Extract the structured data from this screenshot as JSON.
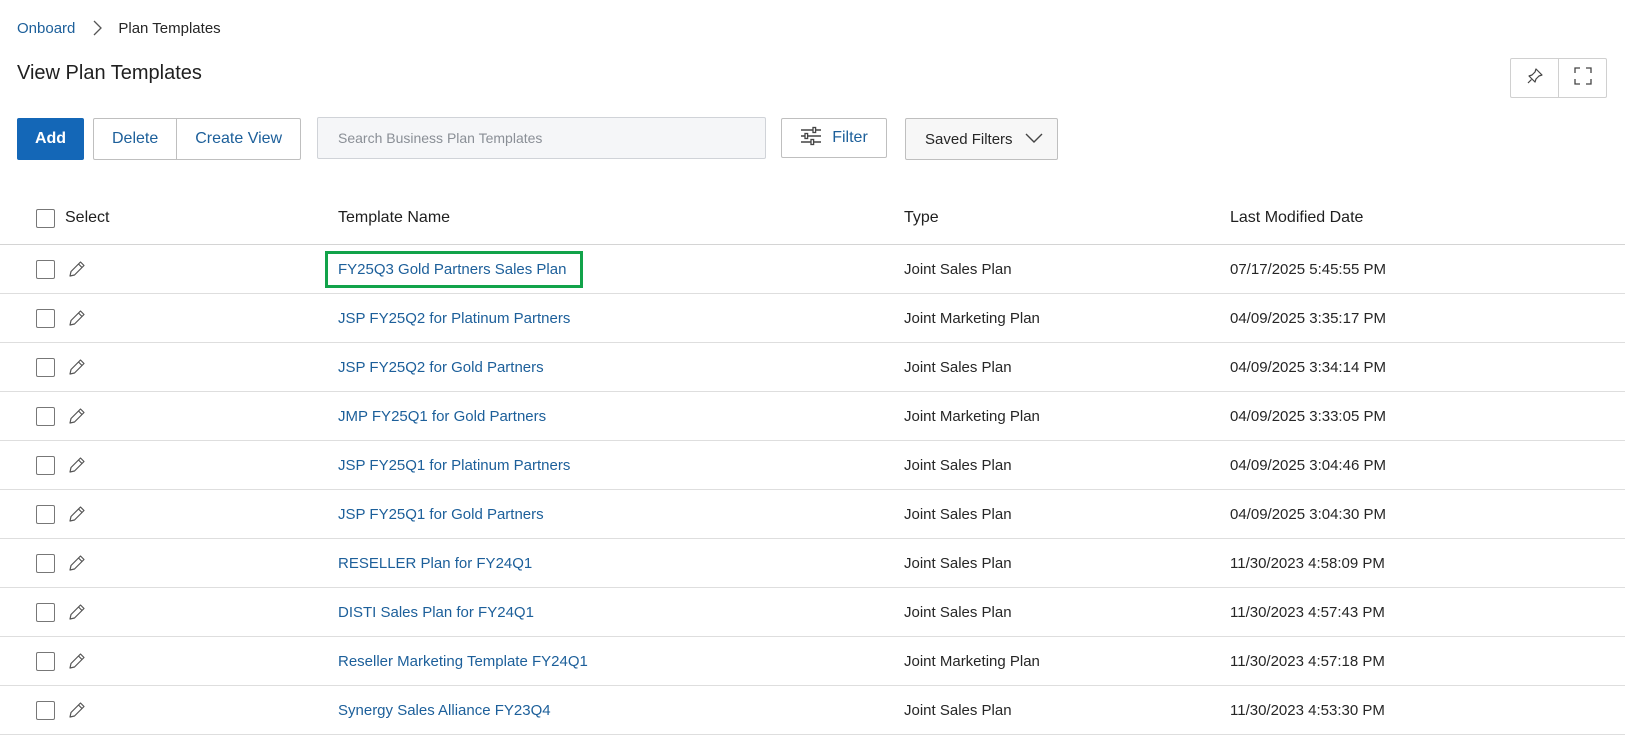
{
  "breadcrumb": {
    "parent": "Onboard",
    "current": "Plan Templates"
  },
  "page_title": "View Plan Templates",
  "toolbar": {
    "add": "Add",
    "delete": "Delete",
    "create_view": "Create View",
    "search_placeholder": "Search Business Plan Templates",
    "filter": "Filter",
    "saved_filters": "Saved Filters"
  },
  "table": {
    "headers": {
      "select": "Select",
      "name": "Template Name",
      "type": "Type",
      "modified": "Last Modified Date"
    },
    "rows": [
      {
        "name": "FY25Q3 Gold Partners Sales Plan",
        "type": "Joint Sales Plan",
        "modified": "07/17/2025 5:45:55 PM"
      },
      {
        "name": "JSP FY25Q2 for Platinum Partners",
        "type": "Joint Marketing Plan",
        "modified": "04/09/2025 3:35:17 PM"
      },
      {
        "name": "JSP FY25Q2 for Gold Partners",
        "type": "Joint Sales Plan",
        "modified": "04/09/2025 3:34:14 PM"
      },
      {
        "name": "JMP FY25Q1 for Gold Partners",
        "type": "Joint Marketing Plan",
        "modified": "04/09/2025 3:33:05 PM"
      },
      {
        "name": "JSP FY25Q1 for Platinum Partners",
        "type": "Joint Sales Plan",
        "modified": "04/09/2025 3:04:46 PM"
      },
      {
        "name": "JSP FY25Q1 for Gold Partners",
        "type": "Joint Sales Plan",
        "modified": "04/09/2025 3:04:30 PM"
      },
      {
        "name": "RESELLER Plan for FY24Q1",
        "type": "Joint Sales Plan",
        "modified": "11/30/2023 4:58:09 PM"
      },
      {
        "name": "DISTI Sales Plan for FY24Q1",
        "type": "Joint Sales Plan",
        "modified": "11/30/2023 4:57:43 PM"
      },
      {
        "name": "Reseller Marketing Template FY24Q1",
        "type": "Joint Marketing Plan",
        "modified": "11/30/2023 4:57:18 PM"
      },
      {
        "name": "Synergy Sales Alliance FY23Q4",
        "type": "Joint Sales Plan",
        "modified": "11/30/2023 4:53:30 PM"
      }
    ]
  },
  "colors": {
    "link": "#1c5f9a",
    "primary": "#1467b7",
    "highlight": "#12a34a"
  },
  "icons": [
    "chevron-right-icon",
    "pin-icon",
    "expand-icon",
    "filter-sliders-icon",
    "chevron-down-icon",
    "pencil-icon"
  ]
}
